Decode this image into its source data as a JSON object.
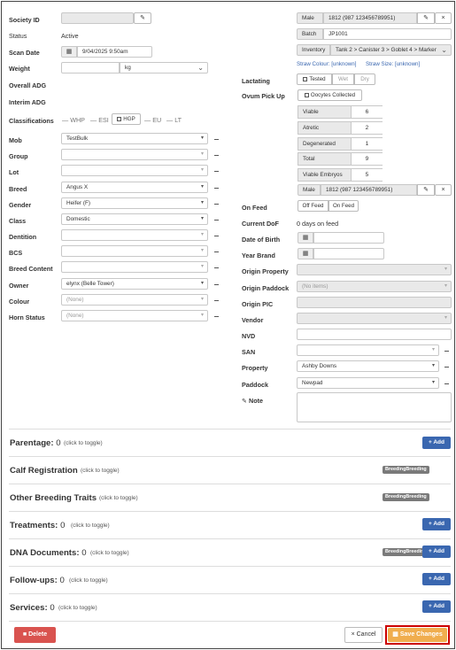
{
  "left": {
    "society_id_label": "Society ID",
    "status_label": "Status",
    "status_value": "Active",
    "scan_date_label": "Scan Date",
    "scan_date_value": "9/04/2025 9:50am",
    "weight_label": "Weight",
    "weight_unit": "kg",
    "overall_adg_label": "Overall ADG",
    "interim_adg_label": "Interim ADG",
    "classifications_label": "Classifications",
    "classifications": [
      "WHP",
      "ESI",
      "HGP",
      "EU",
      "LT"
    ],
    "mob_label": "Mob",
    "mob_value": "TestBulk",
    "group_label": "Group",
    "lot_label": "Lot",
    "breed_label": "Breed",
    "breed_value": "Angus X",
    "gender_label": "Gender",
    "gender_value": "Heifer (F)",
    "class_label": "Class",
    "class_value": "Domestic",
    "dentition_label": "Dentition",
    "bcs_label": "BCS",
    "breed_content_label": "Breed Content",
    "owner_label": "Owner",
    "owner_value": "elynx (Belle Tower)",
    "colour_label": "Colour",
    "colour_value": "(None)",
    "horn_status_label": "Horn Status",
    "horn_status_value": "(None)"
  },
  "right": {
    "male_label": "Male",
    "male_value": "1812 (987 123456789951)",
    "batch_label": "Batch",
    "batch_value": "JP1001",
    "inventory_label": "Inventory",
    "inventory_value": "Tank 2 > Canister 3 > Goblet 4 > Marker",
    "straw_colour": "Straw Colour: [unknown]",
    "straw_size": "Straw Size: [unknown]",
    "lactating_label": "Lactating",
    "lactating_options": [
      "Tested",
      "Wet",
      "Dry"
    ],
    "opu_label": "Ovum Pick Up",
    "oocytes_label": "Oocytes Collected",
    "opu_rows": [
      {
        "label": "Viable",
        "value": "6"
      },
      {
        "label": "Atretic",
        "value": "2"
      },
      {
        "label": "Degenerated",
        "value": "1"
      },
      {
        "label": "Total",
        "value": "9"
      },
      {
        "label": "Viable Embryos",
        "value": "5"
      }
    ],
    "male2_label": "Male",
    "male2_value": "1812 (987 123456789951)",
    "on_feed_label": "On Feed",
    "off_feed_btn": "Off Feed",
    "on_feed_btn": "On Feed",
    "current_dof_label": "Current DoF",
    "current_dof_value": "0 days on feed",
    "dob_label": "Date of Birth",
    "year_brand_label": "Year Brand",
    "origin_property_label": "Origin Property",
    "origin_paddock_label": "Origin Paddock",
    "origin_paddock_value": "(No items)",
    "origin_pic_label": "Origin PIC",
    "vendor_label": "Vendor",
    "nvd_label": "NVD",
    "san_label": "SAN",
    "property_label": "Property",
    "property_value": "Ashby Downs",
    "paddock_label": "Paddock",
    "paddock_value": "Newpad",
    "note_label": "Note"
  },
  "sections": [
    {
      "title": "Parentage:",
      "count": "0",
      "toggle": "(click to toggle)",
      "add": "+ Add",
      "tag": ""
    },
    {
      "title": "Calf Registration",
      "count": "",
      "toggle": "(click to toggle)",
      "add": "",
      "tag": "BreedingBreeding"
    },
    {
      "title": "Other Breeding Traits",
      "count": "",
      "toggle": "(click to toggle)",
      "add": "",
      "tag": "BreedingBreeding"
    },
    {
      "title": "Treatments:",
      "count": "0",
      "toggle": "(click to toggle)",
      "add": "+ Add",
      "tag": ""
    },
    {
      "title": "DNA Documents:",
      "count": "0",
      "toggle": "(click to toggle)",
      "add": "+ Add",
      "tag": "BreedingBreeding"
    },
    {
      "title": "Follow-ups:",
      "count": "0",
      "toggle": "(click to toggle)",
      "add": "+ Add",
      "tag": ""
    },
    {
      "title": "Services:",
      "count": "0",
      "toggle": "(click to toggle)",
      "add": "+ Add",
      "tag": ""
    }
  ],
  "footer": {
    "delete_label": "Delete",
    "cancel_label": "Cancel",
    "save_label": "Save Changes"
  },
  "colors": {
    "add_button": "#3a67b0",
    "delete_button": "#d9534f",
    "save_button": "#f0ad4e",
    "save_highlight": "#cc0000"
  }
}
